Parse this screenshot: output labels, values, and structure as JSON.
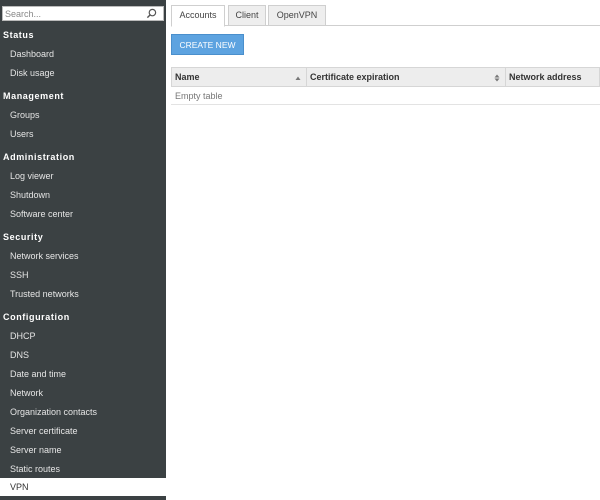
{
  "sidebar": {
    "search_placeholder": "Search...",
    "sections": [
      {
        "header": "Status",
        "items": [
          "Dashboard",
          "Disk usage"
        ]
      },
      {
        "header": "Management",
        "items": [
          "Groups",
          "Users"
        ]
      },
      {
        "header": "Administration",
        "items": [
          "Log viewer",
          "Shutdown",
          "Software center"
        ]
      },
      {
        "header": "Security",
        "items": [
          "Network services",
          "SSH",
          "Trusted networks"
        ]
      },
      {
        "header": "Configuration",
        "items": [
          "DHCP",
          "DNS",
          "Date and time",
          "Network",
          "Organization contacts",
          "Server certificate",
          "Server name",
          "Static routes"
        ]
      }
    ],
    "active_item": "VPN"
  },
  "tabs": [
    "Accounts",
    "Client",
    "OpenVPN"
  ],
  "active_tab": "Accounts",
  "create_button_label": "CREATE NEW",
  "table": {
    "columns": [
      "Name",
      "Certificate expiration",
      "Network address"
    ],
    "empty_text": "Empty table"
  },
  "colors": {
    "sidebar_bg": "#3b4143",
    "accent": "#5da3e0"
  }
}
